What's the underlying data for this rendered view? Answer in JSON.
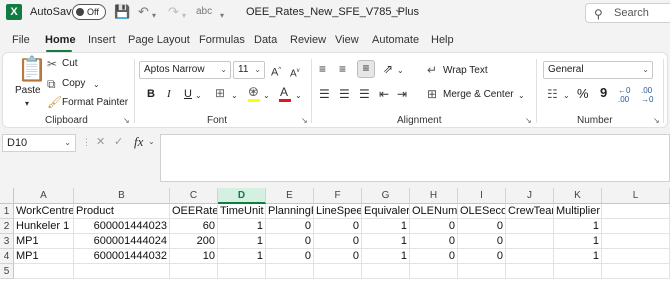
{
  "titlebar": {
    "autosave_label": "AutoSave",
    "autosave_state": "Off",
    "filename": "OEE_Rates_New_SFE_V785_Plus",
    "search_placeholder": "Search"
  },
  "menu": [
    "File",
    "Home",
    "Insert",
    "Page Layout",
    "Formulas",
    "Data",
    "Review",
    "View",
    "Automate",
    "Help"
  ],
  "ribbon": {
    "clipboard": {
      "paste": "Paste",
      "cut": "Cut",
      "copy": "Copy",
      "format_painter": "Format Painter",
      "label": "Clipboard"
    },
    "font": {
      "font_name": "Aptos Narrow",
      "font_size": "11",
      "bold": "B",
      "italic": "I",
      "underline": "U",
      "label": "Font"
    },
    "alignment": {
      "wrap_text": "Wrap Text",
      "merge_center": "Merge & Center",
      "label": "Alignment"
    },
    "number": {
      "format": "General",
      "percent": "%",
      "comma": "9",
      "label": "Number"
    }
  },
  "formula_bar": {
    "name_box": "D10",
    "fx": "fx",
    "formula": ""
  },
  "sheet": {
    "columns": [
      "A",
      "B",
      "C",
      "D",
      "E",
      "F",
      "G",
      "H",
      "I",
      "J",
      "K",
      "L"
    ],
    "selected_column": "D",
    "rows": [
      {
        "num": "1",
        "cells": [
          "WorkCentre",
          "Product",
          "OEERate",
          "TimeUnit",
          "PlanningF",
          "LineSpeed",
          "Equivaler",
          "OLENumF",
          "OLESecor",
          "CrewTeam",
          "Multiplier",
          ""
        ]
      },
      {
        "num": "2",
        "cells": [
          "Hunkeler 1",
          "600001444023",
          "60",
          "1",
          "0",
          "0",
          "1",
          "0",
          "0",
          "",
          "1",
          ""
        ]
      },
      {
        "num": "3",
        "cells": [
          "MP1",
          "600001444024",
          "200",
          "1",
          "0",
          "0",
          "1",
          "0",
          "0",
          "",
          "1",
          ""
        ]
      },
      {
        "num": "4",
        "cells": [
          "MP1",
          "600001444032",
          "10",
          "1",
          "0",
          "0",
          "1",
          "0",
          "0",
          "",
          "1",
          ""
        ]
      },
      {
        "num": "5",
        "cells": [
          "",
          "",
          "",
          "",
          "",
          "",
          "",
          "",
          "",
          "",
          "",
          ""
        ]
      }
    ]
  }
}
